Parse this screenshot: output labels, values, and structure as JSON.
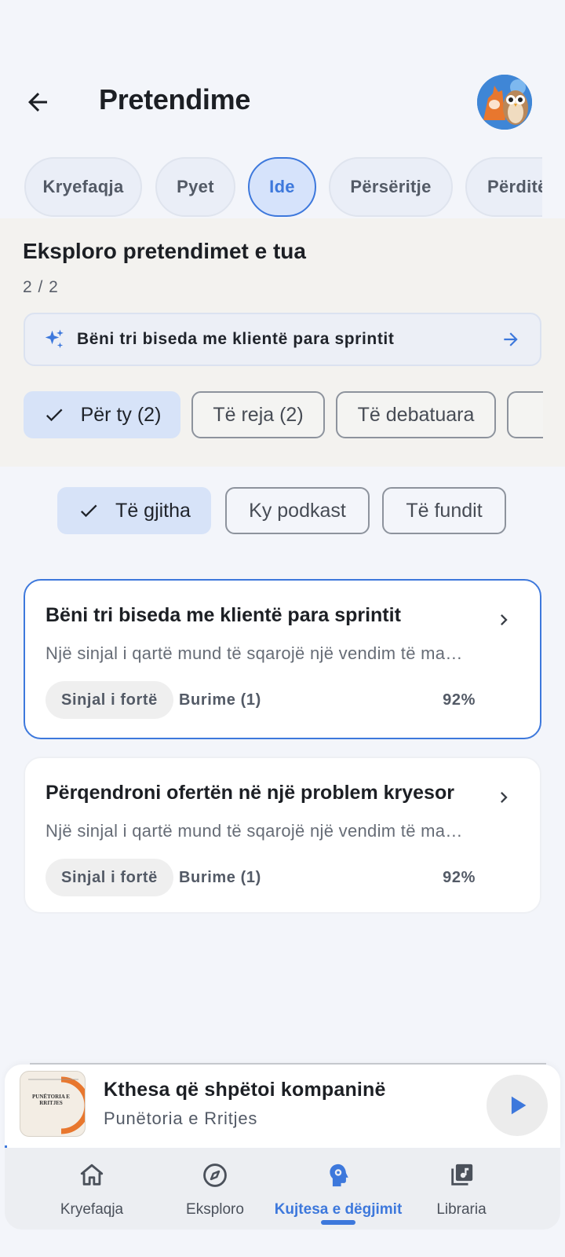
{
  "header": {
    "title": "Pretendime"
  },
  "tabs": [
    {
      "label": "Kryefaqja",
      "active": false
    },
    {
      "label": "Pyet",
      "active": false
    },
    {
      "label": "Ide",
      "active": true
    },
    {
      "label": "Përsëritje",
      "active": false
    },
    {
      "label": "Përditë",
      "active": false
    }
  ],
  "section": {
    "title": "Eksploro pretendimet e tua",
    "count": "2 / 2",
    "promo_text": "Bëni tri biseda me klientë para sprintit"
  },
  "chips": [
    {
      "label": "Për ty (2)",
      "selected": true
    },
    {
      "label": "Të reja (2)",
      "selected": false
    },
    {
      "label": "Të debatuara",
      "selected": false
    }
  ],
  "filters": [
    {
      "label": "Të gjitha",
      "selected": true
    },
    {
      "label": "Ky podkast",
      "selected": false
    },
    {
      "label": "Të fundit",
      "selected": false
    }
  ],
  "cards": [
    {
      "title": "Bëni tri biseda me klientë para sprintit",
      "description": "Një sinjal i qartë mund të sqarojë një vendim të ma…",
      "badge": "Sinjal i fortë",
      "sources": "Burime (1)",
      "percent": "92%"
    },
    {
      "title": "Përqendroni ofertën në një problem kryesor",
      "description": "Një sinjal i qartë mund të sqarojë një vendim të ma…",
      "badge": "Sinjal i fortë",
      "sources": "Burime (1)",
      "percent": "92%"
    }
  ],
  "player": {
    "title": "Kthesa që shpëtoi kompaninë",
    "subtitle": "Punëtoria e Rritjes",
    "cover_text": "PUNËTORIA E RRITJES",
    "progress": 0.004
  },
  "nav": [
    {
      "label": "Kryefaqja",
      "icon": "home-icon",
      "active": false
    },
    {
      "label": "Eksploro",
      "icon": "compass-icon",
      "active": false
    },
    {
      "label": "Kujtesa e dëgjimit",
      "icon": "memory-icon",
      "active": true
    },
    {
      "label": "Libraria",
      "icon": "library-icon",
      "active": false
    }
  ],
  "colors": {
    "accent": "#3d78dc",
    "background": "#f3f5fa"
  }
}
